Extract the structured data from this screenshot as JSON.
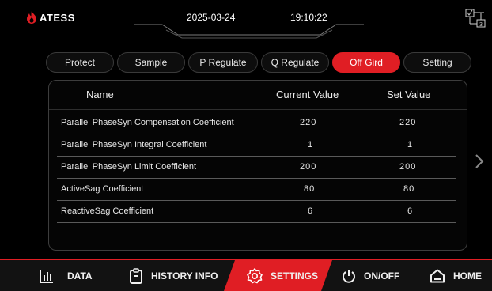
{
  "header": {
    "brand": "ATESS",
    "date": "2025-03-24",
    "time": "19:10:22"
  },
  "tabs": [
    {
      "label": "Protect",
      "active": false
    },
    {
      "label": "Sample",
      "active": false
    },
    {
      "label": "P Regulate",
      "active": false
    },
    {
      "label": "Q Regulate",
      "active": false
    },
    {
      "label": "Off Gird",
      "active": true
    },
    {
      "label": "Setting",
      "active": false
    }
  ],
  "table": {
    "headers": {
      "name": "Name",
      "current": "Current Value",
      "set": "Set Value"
    },
    "rows": [
      {
        "name": "Parallel PhaseSyn Compensation Coefficient",
        "current": "220",
        "set": "220"
      },
      {
        "name": "Parallel PhaseSyn Integral Coefficient",
        "current": "1",
        "set": "1"
      },
      {
        "name": "Parallel PhaseSyn  Limit Coefficient",
        "current": "200",
        "set": "200"
      },
      {
        "name": "ActiveSag Coefficient",
        "current": "80",
        "set": "80"
      },
      {
        "name": "ReactiveSag Coefficient",
        "current": "6",
        "set": "6"
      }
    ]
  },
  "bottom_nav": [
    {
      "label": "DATA",
      "icon": "bar-chart-icon",
      "active": false
    },
    {
      "label": "HISTORY INFO",
      "icon": "clipboard-icon",
      "active": false
    },
    {
      "label": "SETTINGS",
      "icon": "gear-icon",
      "active": true
    },
    {
      "label": "ON/OFF",
      "icon": "power-icon",
      "active": false
    },
    {
      "label": "HOME",
      "icon": "home-icon",
      "active": false
    }
  ],
  "colors": {
    "accent": "#e01e24",
    "background": "#000000"
  }
}
